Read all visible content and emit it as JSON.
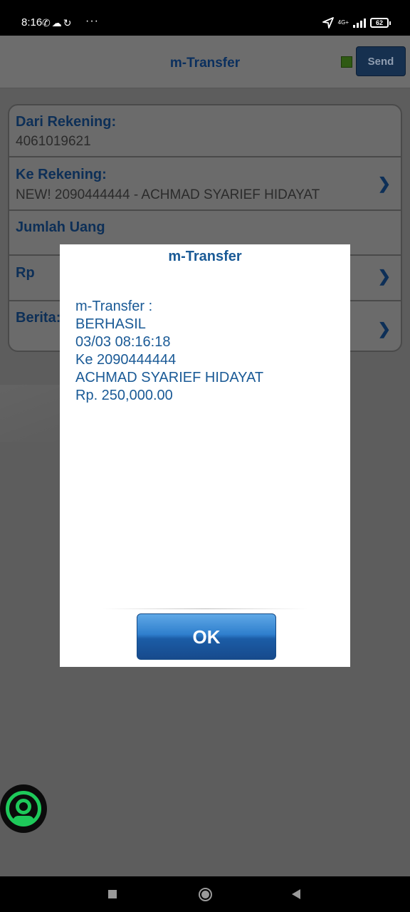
{
  "status_bar": {
    "time": "8:16",
    "left_icons": [
      "whatsapp-icon",
      "cloud-icon",
      "sync-icon"
    ],
    "more": "···",
    "network": "4G+",
    "battery": "62"
  },
  "header": {
    "title": "m-Transfer",
    "send_label": "Send",
    "status_color": "#4caf1a"
  },
  "form": {
    "from_label": "Dari Rekening:",
    "from_value": "4061019621",
    "to_label": "Ke Rekening:",
    "to_value": "NEW! 2090444444 - ACHMAD SYARIEF HIDAYAT",
    "amount_label": "Jumlah Uang",
    "currency_label": "Rp",
    "message_label": "Berita:"
  },
  "dialog": {
    "title": "m-Transfer",
    "lines": [
      "m-Transfer :",
      "BERHASIL",
      "03/03 08:16:18",
      "Ke 2090444444",
      "ACHMAD SYARIEF HIDAYAT",
      "Rp. 250,000.00"
    ],
    "ok_label": "OK"
  },
  "colors": {
    "accent": "#1a5a96",
    "ok_button": "#1b5ca6",
    "floater": "#1ec95a"
  }
}
